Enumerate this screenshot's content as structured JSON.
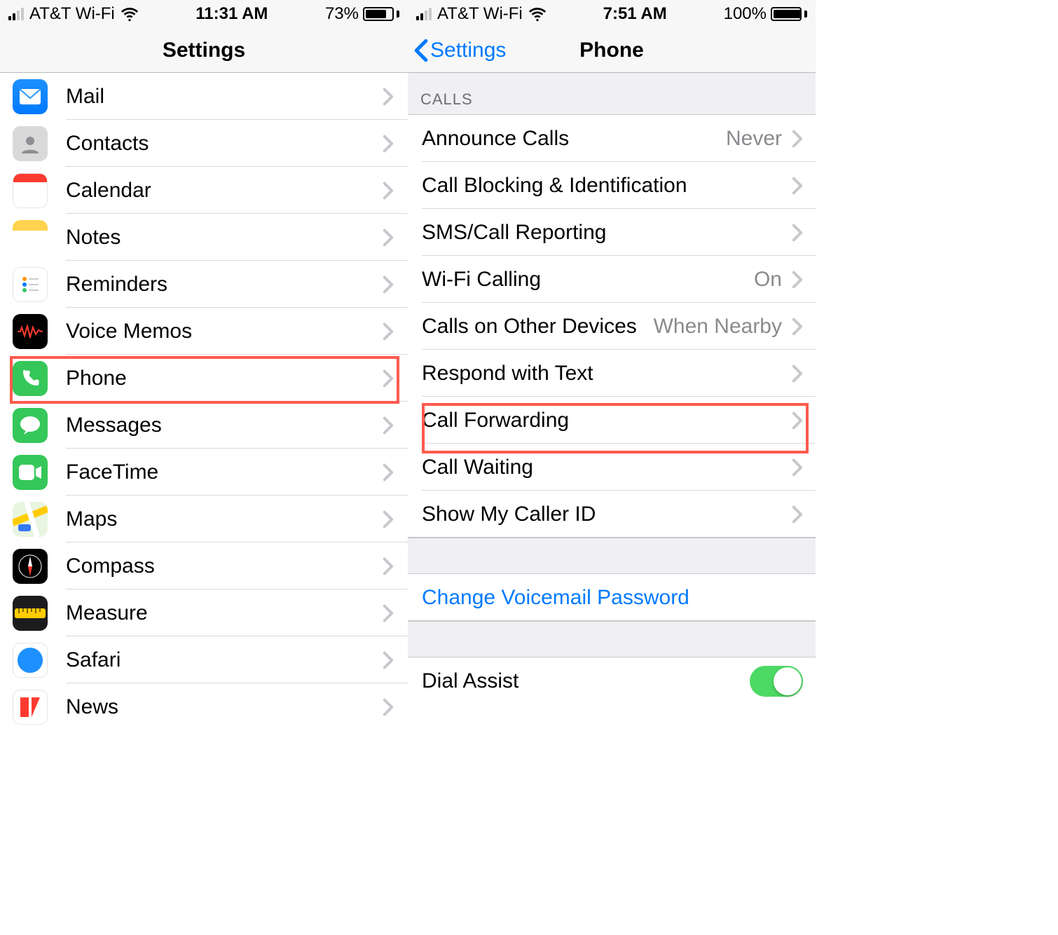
{
  "left": {
    "status": {
      "carrier": "AT&T Wi-Fi",
      "time": "11:31 AM",
      "battery_pct": "73%",
      "battery_fill": 73
    },
    "nav": {
      "title": "Settings"
    },
    "rows": [
      {
        "label": "Mail"
      },
      {
        "label": "Contacts"
      },
      {
        "label": "Calendar"
      },
      {
        "label": "Notes"
      },
      {
        "label": "Reminders"
      },
      {
        "label": "Voice Memos"
      },
      {
        "label": "Phone"
      },
      {
        "label": "Messages"
      },
      {
        "label": "FaceTime"
      },
      {
        "label": "Maps"
      },
      {
        "label": "Compass"
      },
      {
        "label": "Measure"
      },
      {
        "label": "Safari"
      },
      {
        "label": "News"
      }
    ]
  },
  "right": {
    "status": {
      "carrier": "AT&T Wi-Fi",
      "time": "7:51 AM",
      "battery_pct": "100%",
      "battery_fill": 100
    },
    "nav": {
      "back": "Settings",
      "title": "Phone"
    },
    "section_calls": "CALLS",
    "rows": {
      "announce": {
        "label": "Announce Calls",
        "value": "Never"
      },
      "blocking": {
        "label": "Call Blocking & Identification"
      },
      "sms": {
        "label": "SMS/Call Reporting"
      },
      "wifi": {
        "label": "Wi-Fi Calling",
        "value": "On"
      },
      "other": {
        "label": "Calls on Other Devices",
        "value": "When Nearby"
      },
      "respond": {
        "label": "Respond with Text"
      },
      "fwd": {
        "label": "Call Forwarding"
      },
      "wait": {
        "label": "Call Waiting"
      },
      "caller": {
        "label": "Show My Caller ID"
      },
      "voicemail": {
        "label": "Change Voicemail Password"
      },
      "dial": {
        "label": "Dial Assist"
      }
    }
  }
}
